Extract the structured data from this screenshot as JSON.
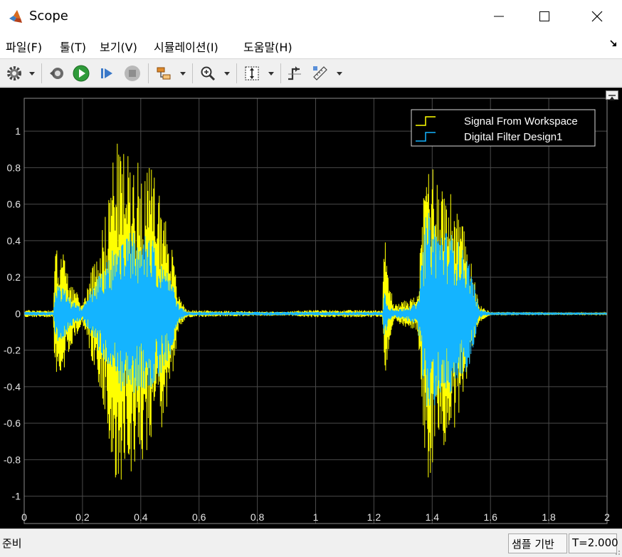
{
  "window": {
    "title": "Scope"
  },
  "menu": [
    {
      "label": "파일(F)"
    },
    {
      "label": "툴(T)"
    },
    {
      "label": "보기(V)"
    },
    {
      "label": "시뮬레이션(I)"
    },
    {
      "label": "도움말(H)"
    }
  ],
  "toolbar": {
    "icons": [
      "settings-icon",
      "restore-icon",
      "run-icon",
      "step-forward-icon",
      "stop-icon",
      "highlight-block-icon",
      "zoom-in-icon",
      "autoscale-icon",
      "triggers-icon",
      "measurements-icon"
    ]
  },
  "status": {
    "ready": "준비",
    "sample_based": "샘플 기반",
    "time": "T=2.000"
  },
  "colors": {
    "signal_yellow": "#ffff00",
    "signal_blue": "#14b4ff",
    "grid": "#4a4a4a",
    "plot_bg": "#000000"
  },
  "chart_data": {
    "type": "line",
    "xlim": [
      0,
      2
    ],
    "ylim": [
      -1.15,
      1.18
    ],
    "xticks": [
      "0",
      "0.2",
      "0.4",
      "0.6",
      "0.8",
      "1",
      "1.2",
      "1.4",
      "1.6",
      "1.8",
      "2"
    ],
    "yticks": [
      "1",
      "0.8",
      "0.6",
      "0.4",
      "0.2",
      "0",
      "-0.2",
      "-0.4",
      "-0.6",
      "-0.8",
      "-1"
    ],
    "xtick_values": [
      0,
      0.2,
      0.4,
      0.6,
      0.8,
      1,
      1.2,
      1.4,
      1.6,
      1.8,
      2
    ],
    "ytick_values": [
      1,
      0.8,
      0.6,
      0.4,
      0.2,
      0,
      -0.2,
      -0.4,
      -0.6,
      -0.8,
      -1
    ],
    "grid": true,
    "legend_position": "top-right",
    "series": [
      {
        "name": "Signal From Workspace",
        "color": "#ffff00",
        "envelope": [
          [
            0,
            0.02
          ],
          [
            0.1,
            0.02
          ],
          [
            0.105,
            0.35
          ],
          [
            0.13,
            0.38
          ],
          [
            0.15,
            0.22
          ],
          [
            0.2,
            0.05
          ],
          [
            0.22,
            0.18
          ],
          [
            0.28,
            0.55
          ],
          [
            0.31,
            0.95
          ],
          [
            0.34,
            0.9
          ],
          [
            0.38,
            0.85
          ],
          [
            0.45,
            0.78
          ],
          [
            0.5,
            0.45
          ],
          [
            0.53,
            0.1
          ],
          [
            0.56,
            0.02
          ],
          [
            0.9,
            0.01
          ],
          [
            0.95,
            0.02
          ],
          [
            1.23,
            0.02
          ],
          [
            1.235,
            0.48
          ],
          [
            1.25,
            0.2
          ],
          [
            1.27,
            0.05
          ],
          [
            1.35,
            0.1
          ],
          [
            1.38,
            0.92
          ],
          [
            1.43,
            0.75
          ],
          [
            1.48,
            0.62
          ],
          [
            1.53,
            0.35
          ],
          [
            1.56,
            0.05
          ],
          [
            1.6,
            0.01
          ],
          [
            2,
            0.005
          ]
        ]
      },
      {
        "name": "Digital Filter Design1",
        "color": "#14b4ff",
        "envelope": [
          [
            0,
            0.01
          ],
          [
            0.1,
            0.01
          ],
          [
            0.105,
            0.15
          ],
          [
            0.13,
            0.18
          ],
          [
            0.15,
            0.1
          ],
          [
            0.2,
            0.03
          ],
          [
            0.22,
            0.1
          ],
          [
            0.28,
            0.3
          ],
          [
            0.33,
            0.45
          ],
          [
            0.38,
            0.48
          ],
          [
            0.45,
            0.42
          ],
          [
            0.5,
            0.25
          ],
          [
            0.53,
            0.05
          ],
          [
            0.56,
            0.01
          ],
          [
            0.9,
            0.01
          ],
          [
            0.95,
            0.01
          ],
          [
            1.23,
            0.01
          ],
          [
            1.235,
            0.15
          ],
          [
            1.25,
            0.05
          ],
          [
            1.27,
            0.02
          ],
          [
            1.35,
            0.06
          ],
          [
            1.38,
            0.6
          ],
          [
            1.43,
            0.5
          ],
          [
            1.48,
            0.45
          ],
          [
            1.53,
            0.3
          ],
          [
            1.56,
            0.03
          ],
          [
            1.6,
            0.005
          ],
          [
            2,
            0.003
          ]
        ]
      }
    ]
  }
}
